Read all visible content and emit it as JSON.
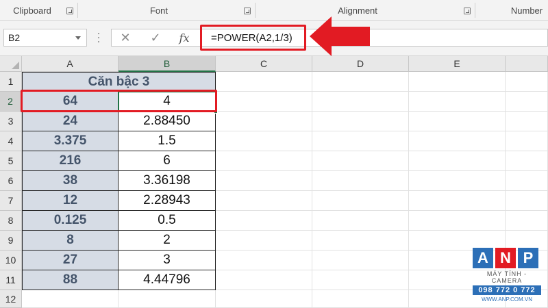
{
  "ribbon": {
    "groups": [
      "Clipboard",
      "Font",
      "Alignment",
      "Number"
    ]
  },
  "formula_bar": {
    "name_box": "B2",
    "cancel_icon": "✕",
    "enter_icon": "✓",
    "fx_label": "fx",
    "formula": "=POWER(A2,1/3)"
  },
  "sheet": {
    "columns": [
      "A",
      "B",
      "C",
      "D",
      "E"
    ],
    "rows": [
      "1",
      "2",
      "3",
      "4",
      "5",
      "6",
      "7",
      "8",
      "9",
      "10",
      "11",
      "12"
    ],
    "title": "Căn bậc 3",
    "data": [
      {
        "a": "64",
        "b": "4"
      },
      {
        "a": "24",
        "b": "2.88450"
      },
      {
        "a": "3.375",
        "b": "1.5"
      },
      {
        "a": "216",
        "b": "6"
      },
      {
        "a": "38",
        "b": "3.36198"
      },
      {
        "a": "12",
        "b": "2.28943"
      },
      {
        "a": "0.125",
        "b": "0.5"
      },
      {
        "a": "8",
        "b": "2"
      },
      {
        "a": "27",
        "b": "3"
      },
      {
        "a": "88",
        "b": "4.44796"
      }
    ],
    "active_cell": "B2"
  },
  "logo": {
    "letters": [
      "A",
      "N",
      "P"
    ],
    "letter_colors": [
      "#2c6fb7",
      "#e21b23",
      "#2c6fb7"
    ],
    "tagline": "MÁY TÍNH - CAMERA",
    "phone": "098 772 0 772",
    "website": "WWW.ANP.COM.VN"
  },
  "colors": {
    "highlight": "#e21b23",
    "selection": "#217346",
    "header_fill": "#d6dce5"
  }
}
